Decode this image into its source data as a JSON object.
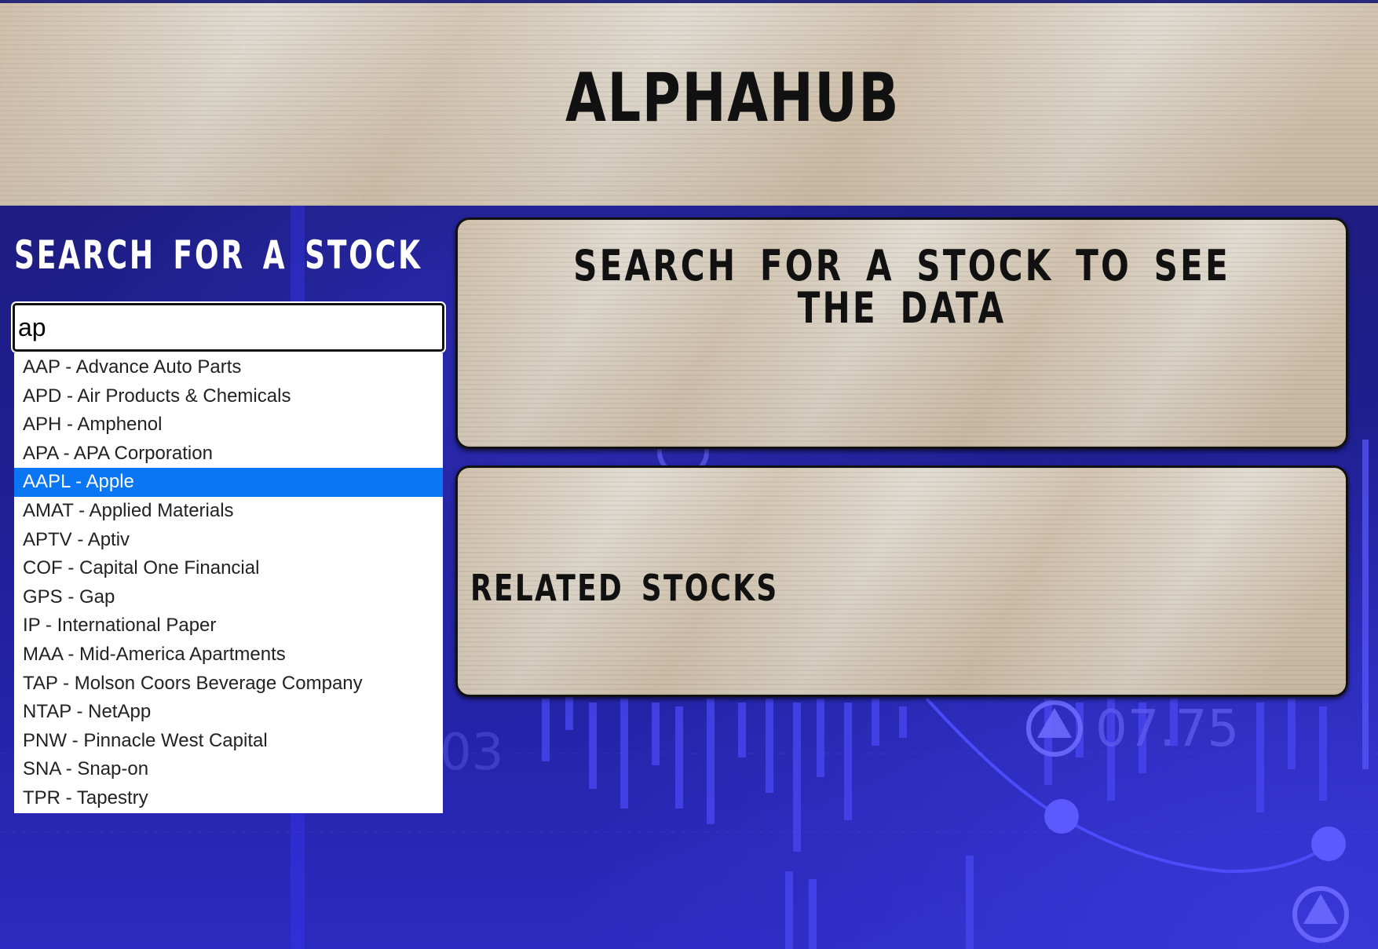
{
  "header": {
    "title": "ALPHAHUB"
  },
  "search": {
    "heading": "SEARCH FOR A STOCK",
    "input_value": "ap",
    "suggestions": [
      "AAP - Advance Auto Parts",
      "APD - Air Products & Chemicals",
      "APH - Amphenol",
      "APA - APA Corporation",
      "AAPL - Apple",
      "AMAT - Applied Materials",
      "APTV - Aptiv",
      "COF - Capital One Financial",
      "GPS - Gap",
      "IP - International Paper",
      "MAA - Mid-America Apartments",
      "TAP - Molson Coors Beverage Company",
      "NTAP - NetApp",
      "PNW - Pinnacle West Capital",
      "SNA - Snap-on",
      "TPR - Tapestry"
    ],
    "selected_suggestion": "AAPL - Apple"
  },
  "data_panel": {
    "heading": "SEARCH FOR A STOCK TO SEE THE DATA"
  },
  "related_panel": {
    "heading": "RELATED STOCKS"
  },
  "background": {
    "ticker_value_left": "03",
    "ticker_value_right": "07.75"
  },
  "colors": {
    "selected_highlight": "#0a76f3",
    "background_blue": "#1a1a6e",
    "accent_blue": "#4a4aff"
  }
}
